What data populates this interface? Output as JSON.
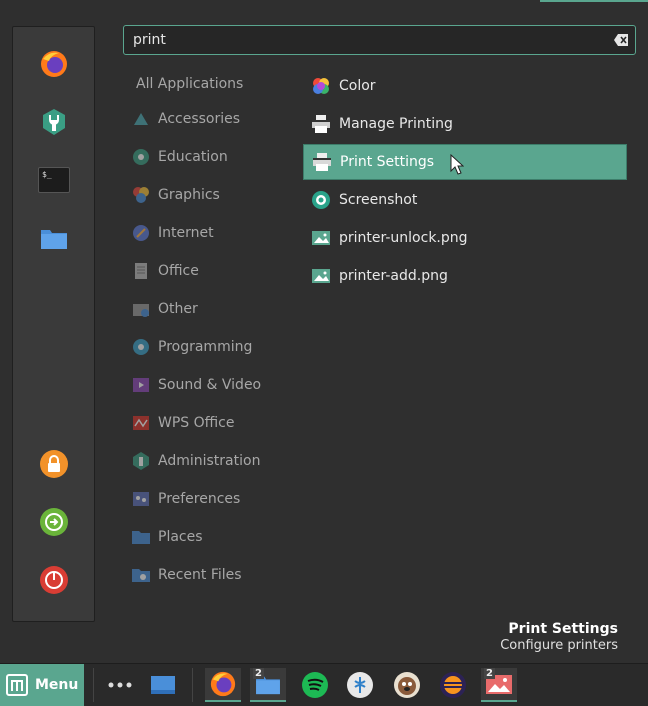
{
  "search": {
    "value": "print"
  },
  "favorites": [
    {
      "icon": "firefox-icon"
    },
    {
      "icon": "software-manager-icon"
    },
    {
      "icon": "terminal-icon",
      "text": "$_"
    },
    {
      "icon": "folder-icon"
    }
  ],
  "session": [
    {
      "icon": "lock-icon"
    },
    {
      "icon": "logout-icon"
    },
    {
      "icon": "power-icon"
    }
  ],
  "categories": [
    {
      "label": "All Applications"
    },
    {
      "label": "Accessories",
      "icon": "accessories-icon"
    },
    {
      "label": "Education",
      "icon": "education-icon"
    },
    {
      "label": "Graphics",
      "icon": "graphics-icon"
    },
    {
      "label": "Internet",
      "icon": "internet-icon"
    },
    {
      "label": "Office",
      "icon": "office-icon"
    },
    {
      "label": "Other",
      "icon": "other-icon"
    },
    {
      "label": "Programming",
      "icon": "programming-icon"
    },
    {
      "label": "Sound & Video",
      "icon": "sound-video-icon"
    },
    {
      "label": "WPS Office",
      "icon": "wps-office-icon"
    },
    {
      "label": "Administration",
      "icon": "administration-icon"
    },
    {
      "label": "Preferences",
      "icon": "preferences-icon"
    },
    {
      "label": "Places",
      "icon": "places-icon"
    },
    {
      "label": "Recent Files",
      "icon": "recent-files-icon"
    }
  ],
  "results": [
    {
      "label": "Color",
      "icon": "color-icon"
    },
    {
      "label": "Manage Printing",
      "icon": "printer-icon"
    },
    {
      "label": "Print Settings",
      "icon": "printer-icon",
      "selected": true
    },
    {
      "label": "Screenshot",
      "icon": "screenshot-icon"
    },
    {
      "label": "printer-unlock.png",
      "icon": "image-file-icon"
    },
    {
      "label": "printer-add.png",
      "icon": "image-file-icon"
    }
  ],
  "description": {
    "title": "Print Settings",
    "text": "Configure printers"
  },
  "panel": {
    "menu_label": "Menu",
    "badges": {
      "files": "2",
      "image_viewer": "2"
    }
  },
  "colors": {
    "accent": "#5aa68f",
    "background": "#2f2f2f",
    "panel": "#2a2a2a"
  }
}
